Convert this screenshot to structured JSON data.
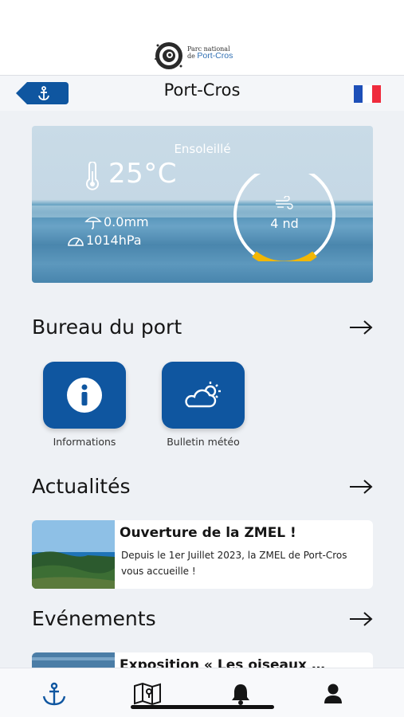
{
  "logo": {
    "line1": "Parc national",
    "line2": "de",
    "brand": "Port-Cros"
  },
  "header": {
    "title": "Port-Cros",
    "back_icon": "anchor-icon",
    "language": "fr"
  },
  "weather": {
    "condition": "Ensoleillé",
    "temperature": "25°C",
    "rain": "0.0mm",
    "pressure": "1014hPa",
    "wind": "4 nd"
  },
  "harbour_office": {
    "title": "Bureau du port",
    "tiles": [
      {
        "label": "Informations",
        "icon": "info-icon"
      },
      {
        "label": "Bulletin météo",
        "icon": "weather-icon"
      }
    ]
  },
  "news": {
    "title": "Actualités",
    "items": [
      {
        "title": "Ouverture de la ZMEL !",
        "body": "Depuis le 1er Juillet 2023, la ZMEL de Port-Cros vous accueille !"
      }
    ]
  },
  "events": {
    "title": "Evénements",
    "items": [
      {
        "title": "Exposition « Les oiseaux …"
      }
    ]
  },
  "tabs": [
    "anchor-icon",
    "map-icon",
    "bell-icon",
    "user-icon"
  ],
  "colors": {
    "accent": "#0f56a0",
    "gauge": "#f2b705",
    "flag_blue": "#1d4fb8",
    "flag_red": "#ef2b3d"
  }
}
